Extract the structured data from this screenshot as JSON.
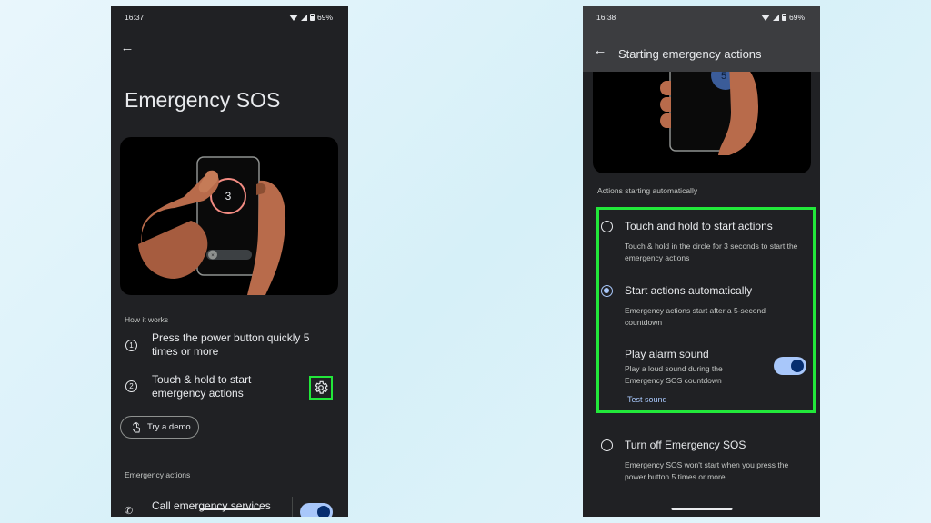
{
  "left": {
    "status": {
      "time": "16:37",
      "battery": "69%"
    },
    "title": "Emergency SOS",
    "illustration": {
      "countdown": "3",
      "slider_icon": "×"
    },
    "how_it_works_label": "How it works",
    "steps": [
      {
        "num": "1",
        "text": "Press the power button quickly 5 times or more"
      },
      {
        "num": "2",
        "text": "Touch & hold to start emergency actions"
      }
    ],
    "demo_label": "Try a demo",
    "emergency_actions_label": "Emergency actions",
    "call_label": "Call emergency services",
    "call_toggle_on": true
  },
  "right": {
    "status": {
      "time": "16:38",
      "battery": "69%"
    },
    "title": "Starting emergency actions",
    "illustration": {
      "countdown": "5"
    },
    "actions_label": "Actions starting automatically",
    "options": [
      {
        "title": "Touch and hold to start actions",
        "desc": "Touch & hold in the circle for 3 seconds to start the emergency actions",
        "selected": false
      },
      {
        "title": "Start actions automatically",
        "desc": "Emergency actions start after a 5-second countdown",
        "selected": true
      }
    ],
    "alarm": {
      "title": "Play alarm sound",
      "desc": "Play a loud sound during the Emergency SOS countdown",
      "on": true
    },
    "test_sound": "Test sound",
    "turn_off": {
      "title": "Turn off Emergency SOS",
      "desc": "Emergency SOS won't start when you press the power button 5 times or more",
      "selected": false
    }
  },
  "colors": {
    "highlight": "#22e83a",
    "accent": "#a8c7fa",
    "surface": "#202124"
  }
}
